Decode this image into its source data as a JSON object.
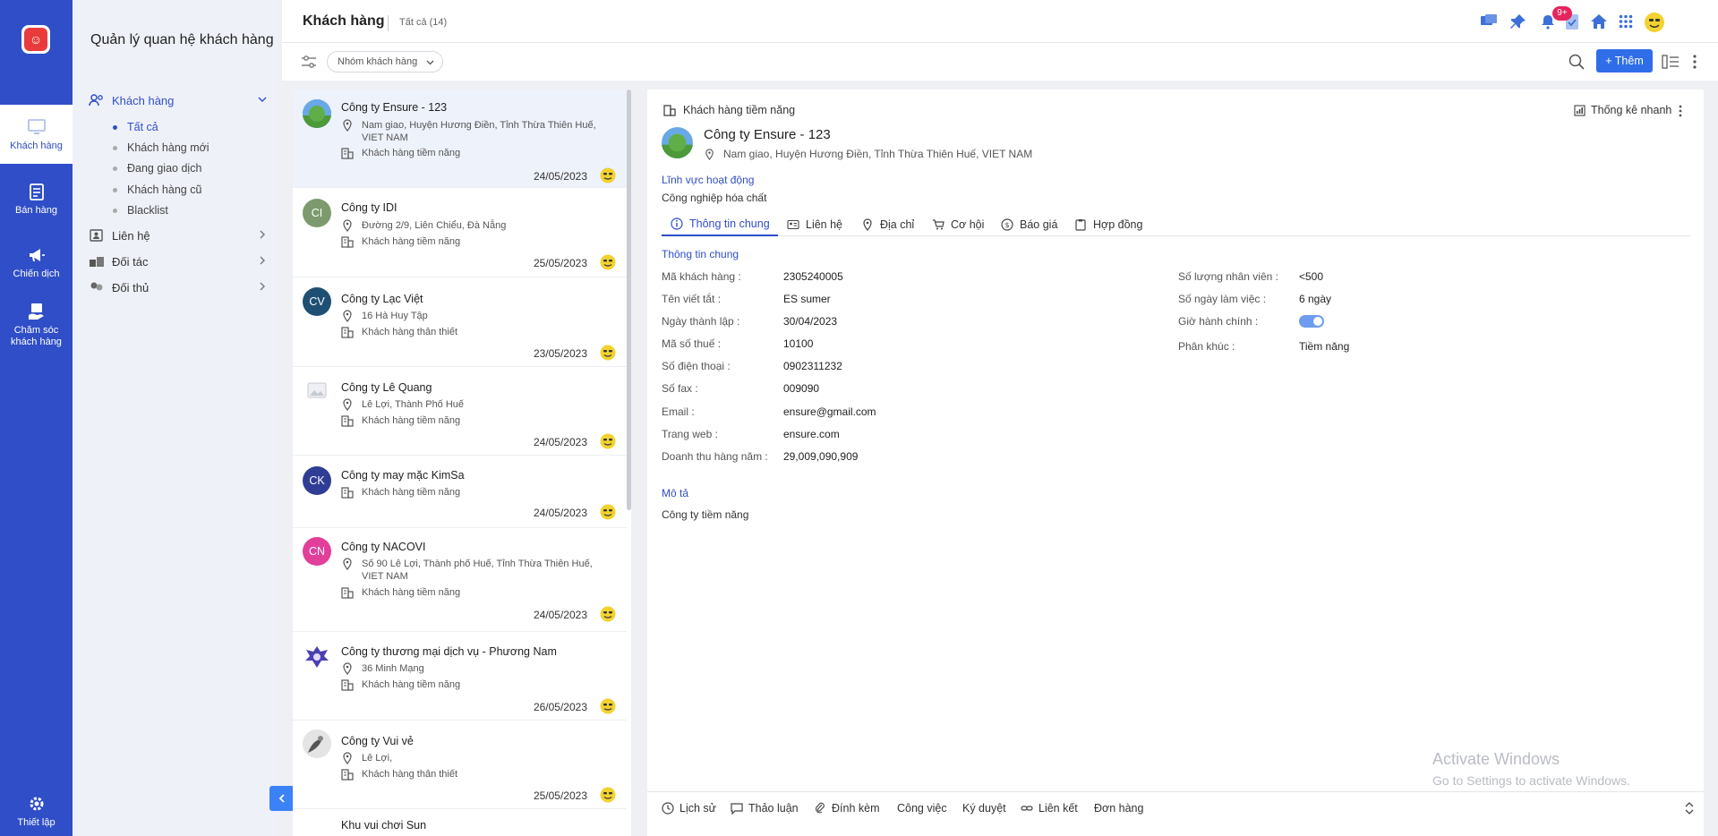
{
  "rail": {
    "items": [
      {
        "label": "Khách hàng",
        "icon": "monitor-icon"
      },
      {
        "label": "Bán hàng",
        "icon": "clipboard-icon"
      },
      {
        "label": "Chiến dịch",
        "icon": "megaphone-icon"
      },
      {
        "label1": "Chăm sóc",
        "label2": "khách hàng",
        "icon": "care-icon"
      }
    ],
    "settings_label": "Thiết lập"
  },
  "menu": {
    "title": "Quản lý quan hệ khách hàng",
    "groups": [
      {
        "label": "Khách hàng",
        "icon": "users-icon"
      },
      {
        "label": "Liên hệ",
        "icon": "contacts-icon"
      },
      {
        "label": "Đối tác",
        "icon": "partners-icon"
      },
      {
        "label": "Đối thủ",
        "icon": "competitors-icon"
      }
    ],
    "sub": [
      "Tất cả",
      "Khách hàng mới",
      "Đang giao dịch",
      "Khách hàng cũ",
      "Blacklist"
    ]
  },
  "header": {
    "title": "Khách hàng",
    "count": "Tất cả (14)",
    "badge": "9+"
  },
  "toolbar": {
    "chip": "Nhóm khách hàng",
    "add_label": "+ Thêm"
  },
  "customers": [
    {
      "name": "Công ty Ensure - 123",
      "address": "Nam giao, Huyện Hương Điền, Tỉnh Thừa Thiên Huế, VIET NAM",
      "type": "Khách hàng tiềm năng",
      "date": "24/05/2023",
      "initials": ""
    },
    {
      "name": "Công ty IDI",
      "address": "Đường 2/9, Liên Chiểu, Đà Nẵng",
      "type": "Khách hàng tiềm năng",
      "date": "25/05/2023",
      "initials": "CI"
    },
    {
      "name": "Công ty Lạc Việt",
      "address": "16 Hà Huy Tập",
      "type": "Khách hàng thân thiết",
      "date": "23/05/2023",
      "initials": "CV"
    },
    {
      "name": "Công ty Lê Quang",
      "address": "Lê Lợi, Thành Phố Huế",
      "type": "Khách hàng tiềm năng",
      "date": "24/05/2023",
      "initials": ""
    },
    {
      "name": "Công ty may mặc KimSa",
      "address": "",
      "type": "Khách hàng tiềm năng",
      "date": "24/05/2023",
      "initials": "CK"
    },
    {
      "name": "Công ty NACOVI",
      "address": "Số 90 Lê Lợi, Thành phố Huế, Tỉnh Thừa Thiên Huế, VIET NAM",
      "type": "Khách hàng tiềm năng",
      "date": "24/05/2023",
      "initials": "CN"
    },
    {
      "name": "Công ty thương mại dịch vụ - Phương Nam",
      "address": "36 Minh Mạng",
      "type": "Khách hàng tiềm năng",
      "date": "26/05/2023",
      "initials": ""
    },
    {
      "name": "Công ty Vui vẻ",
      "address": "Lê Lợi,",
      "type": "Khách hàng thân thiết",
      "date": "25/05/2023",
      "initials": ""
    },
    {
      "name": "Khu vui chơi Sun",
      "address": "",
      "type": "",
      "date": "",
      "initials": ""
    }
  ],
  "colors": {
    "rail": "#2f4ec7",
    "accent": "#2f6ee8",
    "badge": "#e6245e",
    "avatar_ci": "#7d9a6e",
    "avatar_cv": "#1f4f73",
    "avatar_ck": "#2f3d94",
    "avatar_cn": "#e23f9a"
  },
  "detail": {
    "type_label": "Khách hàng tiềm năng",
    "stats_label": "Thống kê nhanh",
    "name": "Công ty Ensure - 123",
    "address": "Nam giao, Huyện Hương Điền, Tỉnh Thừa Thiên Huế, VIET NAM",
    "field_label": "Lĩnh vực hoạt động",
    "field_value": "Công nghiệp hóa chất",
    "tabs": [
      "Thông tin chung",
      "Liên hệ",
      "Địa chỉ",
      "Cơ hội",
      "Báo giá",
      "Hợp đồng"
    ],
    "section_title": "Thông tin chung",
    "left_fields": [
      {
        "label": "Mã khách hàng :",
        "value": "2305240005"
      },
      {
        "label": "Tên viết tắt :",
        "value": "ES sumer"
      },
      {
        "label": "Ngày thành lập :",
        "value": "30/04/2023"
      },
      {
        "label": "Mã số thuế :",
        "value": "10100"
      },
      {
        "label": "Số điện thoại :",
        "value": "0902311232"
      },
      {
        "label": "Số fax :",
        "value": "009090"
      },
      {
        "label": "Email :",
        "value": "ensure@gmail.com"
      },
      {
        "label": "Trang web :",
        "value": "ensure.com"
      },
      {
        "label": "Doanh thu hàng năm :",
        "value": "29,009,090,909"
      }
    ],
    "right_fields": [
      {
        "label": "Số lượng nhân viên :",
        "value": "<500"
      },
      {
        "label": "Số ngày làm việc :",
        "value": "6 ngày"
      },
      {
        "label": "Giờ hành chính :",
        "value": ""
      },
      {
        "label": "Phân khúc :",
        "value": "Tiềm năng"
      }
    ],
    "working_hours_on": true,
    "desc_title": "Mô tả",
    "desc_value": "Công ty tiềm năng"
  },
  "watermark": {
    "line1": "Activate Windows",
    "line2": "Go to Settings to activate Windows."
  },
  "bottombar": [
    "Lịch sử",
    "Thảo luận",
    "Đính kèm",
    "Công việc",
    "Ký duyệt",
    "Liên kết",
    "Đơn hàng"
  ]
}
